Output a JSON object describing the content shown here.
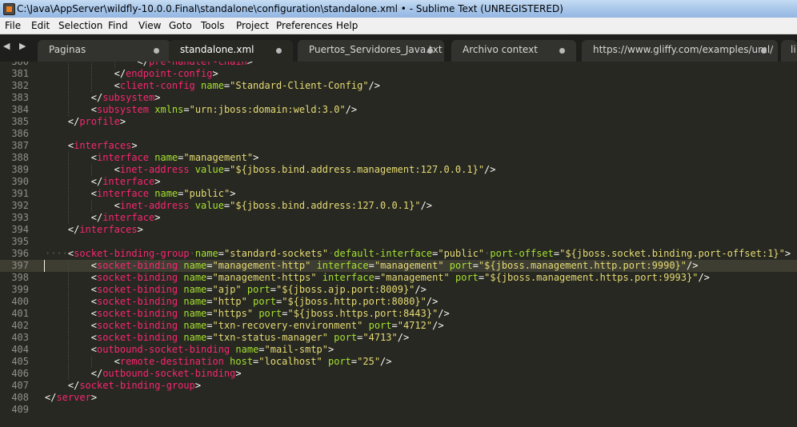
{
  "window": {
    "title": "C:\\Java\\AppServer\\wildfly-10.0.0.Final\\standalone\\configuration\\standalone.xml • - Sublime Text (UNREGISTERED)"
  },
  "menu": [
    "File",
    "Edit",
    "Selection",
    "Find",
    "View",
    "Goto",
    "Tools",
    "Project",
    "Preferences",
    "Help"
  ],
  "nav": {
    "arrows": "◀ ▶"
  },
  "tabs": [
    {
      "label": "Paginas",
      "active": false
    },
    {
      "label": "standalone.xml",
      "active": true
    },
    {
      "label": "Puertos_Servidores_Java.txt",
      "active": false
    },
    {
      "label": "Archivo context",
      "active": false
    },
    {
      "label": "https://www.gliffy.com/examples/uml/",
      "active": false
    },
    {
      "label": "li",
      "active": false
    }
  ],
  "colors": {
    "tag": "#f92672",
    "attr": "#a6e22e",
    "string": "#e6db74",
    "text": "#f8f8f2",
    "background": "#272822",
    "line_number": "#8f908a"
  },
  "editor": {
    "current_line": "397",
    "lines": [
      {
        "n": "380",
        "indent": 16,
        "tokens": [
          [
            "p",
            "</"
          ],
          [
            "t",
            "pre-handler-chain"
          ],
          [
            "p",
            ">"
          ]
        ]
      },
      {
        "n": "381",
        "indent": 12,
        "tokens": [
          [
            "p",
            "</"
          ],
          [
            "t",
            "endpoint-config"
          ],
          [
            "p",
            ">"
          ]
        ]
      },
      {
        "n": "382",
        "indent": 12,
        "tokens": [
          [
            "p",
            "<"
          ],
          [
            "t",
            "client-config"
          ],
          [
            "p",
            " "
          ],
          [
            "a",
            "name"
          ],
          [
            "p",
            "="
          ],
          [
            "s",
            "\"Standard-Client-Config\""
          ],
          [
            "p",
            "/>"
          ]
        ]
      },
      {
        "n": "383",
        "indent": 8,
        "tokens": [
          [
            "p",
            "</"
          ],
          [
            "t",
            "subsystem"
          ],
          [
            "p",
            ">"
          ]
        ]
      },
      {
        "n": "384",
        "indent": 8,
        "tokens": [
          [
            "p",
            "<"
          ],
          [
            "t",
            "subsystem"
          ],
          [
            "p",
            " "
          ],
          [
            "a",
            "xmlns"
          ],
          [
            "p",
            "="
          ],
          [
            "s",
            "\"urn:jboss:domain:weld:3.0\""
          ],
          [
            "p",
            "/>"
          ]
        ]
      },
      {
        "n": "385",
        "indent": 4,
        "tokens": [
          [
            "p",
            "</"
          ],
          [
            "t",
            "profile"
          ],
          [
            "p",
            ">"
          ]
        ]
      },
      {
        "n": "386",
        "indent": 0,
        "tokens": []
      },
      {
        "n": "387",
        "indent": 4,
        "tokens": [
          [
            "p",
            "<"
          ],
          [
            "t",
            "interfaces"
          ],
          [
            "p",
            ">"
          ]
        ]
      },
      {
        "n": "388",
        "indent": 8,
        "tokens": [
          [
            "p",
            "<"
          ],
          [
            "t",
            "interface"
          ],
          [
            "p",
            " "
          ],
          [
            "a",
            "name"
          ],
          [
            "p",
            "="
          ],
          [
            "s",
            "\"management\""
          ],
          [
            "p",
            ">"
          ]
        ]
      },
      {
        "n": "389",
        "indent": 12,
        "tokens": [
          [
            "p",
            "<"
          ],
          [
            "t",
            "inet-address"
          ],
          [
            "p",
            " "
          ],
          [
            "a",
            "value"
          ],
          [
            "p",
            "="
          ],
          [
            "s",
            "\"${jboss.bind.address.management:127.0.0.1}\""
          ],
          [
            "p",
            "/>"
          ]
        ]
      },
      {
        "n": "390",
        "indent": 8,
        "tokens": [
          [
            "p",
            "</"
          ],
          [
            "t",
            "interface"
          ],
          [
            "p",
            ">"
          ]
        ]
      },
      {
        "n": "391",
        "indent": 8,
        "tokens": [
          [
            "p",
            "<"
          ],
          [
            "t",
            "interface"
          ],
          [
            "p",
            " "
          ],
          [
            "a",
            "name"
          ],
          [
            "p",
            "="
          ],
          [
            "s",
            "\"public\""
          ],
          [
            "p",
            ">"
          ]
        ]
      },
      {
        "n": "392",
        "indent": 12,
        "tokens": [
          [
            "p",
            "<"
          ],
          [
            "t",
            "inet-address"
          ],
          [
            "p",
            " "
          ],
          [
            "a",
            "value"
          ],
          [
            "p",
            "="
          ],
          [
            "s",
            "\"${jboss.bind.address:127.0.0.1}\""
          ],
          [
            "p",
            "/>"
          ]
        ]
      },
      {
        "n": "393",
        "indent": 8,
        "tokens": [
          [
            "p",
            "</"
          ],
          [
            "t",
            "interface"
          ],
          [
            "p",
            ">"
          ]
        ]
      },
      {
        "n": "394",
        "indent": 4,
        "tokens": [
          [
            "p",
            "</"
          ],
          [
            "t",
            "interfaces"
          ],
          [
            "p",
            ">"
          ]
        ]
      },
      {
        "n": "395",
        "indent": 0,
        "tokens": []
      },
      {
        "n": "396",
        "indent": 0,
        "tokens": [
          [
            "w",
            "····"
          ],
          [
            "p",
            "<"
          ],
          [
            "t",
            "socket-binding-group"
          ],
          [
            "w",
            "·"
          ],
          [
            "a",
            "name"
          ],
          [
            "p",
            "="
          ],
          [
            "s",
            "\"standard-sockets\""
          ],
          [
            "w",
            "·"
          ],
          [
            "a",
            "default-interface"
          ],
          [
            "p",
            "="
          ],
          [
            "s",
            "\"public\""
          ],
          [
            "w",
            "·"
          ],
          [
            "a",
            "port-offset"
          ],
          [
            "p",
            "="
          ],
          [
            "s",
            "\"${jboss.socket.binding.port-offset:1}\""
          ],
          [
            "p",
            ">"
          ]
        ]
      },
      {
        "n": "397",
        "indent": 8,
        "tokens": [
          [
            "p",
            "<"
          ],
          [
            "t",
            "socket-binding"
          ],
          [
            "p",
            " "
          ],
          [
            "a",
            "name"
          ],
          [
            "p",
            "="
          ],
          [
            "s",
            "\"management-http\""
          ],
          [
            "p",
            " "
          ],
          [
            "a",
            "interface"
          ],
          [
            "p",
            "="
          ],
          [
            "s",
            "\"management\""
          ],
          [
            "p",
            " "
          ],
          [
            "a",
            "port"
          ],
          [
            "p",
            "="
          ],
          [
            "s",
            "\"${jboss.management.http.port:9990}\""
          ],
          [
            "p",
            "/>"
          ]
        ]
      },
      {
        "n": "398",
        "indent": 8,
        "tokens": [
          [
            "p",
            "<"
          ],
          [
            "t",
            "socket-binding"
          ],
          [
            "p",
            " "
          ],
          [
            "a",
            "name"
          ],
          [
            "p",
            "="
          ],
          [
            "s",
            "\"management-https\""
          ],
          [
            "p",
            " "
          ],
          [
            "a",
            "interface"
          ],
          [
            "p",
            "="
          ],
          [
            "s",
            "\"management\""
          ],
          [
            "p",
            " "
          ],
          [
            "a",
            "port"
          ],
          [
            "p",
            "="
          ],
          [
            "s",
            "\"${jboss.management.https.port:9993}\""
          ],
          [
            "p",
            "/>"
          ]
        ]
      },
      {
        "n": "399",
        "indent": 8,
        "tokens": [
          [
            "p",
            "<"
          ],
          [
            "t",
            "socket-binding"
          ],
          [
            "p",
            " "
          ],
          [
            "a",
            "name"
          ],
          [
            "p",
            "="
          ],
          [
            "s",
            "\"ajp\""
          ],
          [
            "p",
            " "
          ],
          [
            "a",
            "port"
          ],
          [
            "p",
            "="
          ],
          [
            "s",
            "\"${jboss.ajp.port:8009}\""
          ],
          [
            "p",
            "/>"
          ]
        ]
      },
      {
        "n": "400",
        "indent": 8,
        "tokens": [
          [
            "p",
            "<"
          ],
          [
            "t",
            "socket-binding"
          ],
          [
            "p",
            " "
          ],
          [
            "a",
            "name"
          ],
          [
            "p",
            "="
          ],
          [
            "s",
            "\"http\""
          ],
          [
            "p",
            " "
          ],
          [
            "a",
            "port"
          ],
          [
            "p",
            "="
          ],
          [
            "s",
            "\"${jboss.http.port:8080}\""
          ],
          [
            "p",
            "/>"
          ]
        ]
      },
      {
        "n": "401",
        "indent": 8,
        "tokens": [
          [
            "p",
            "<"
          ],
          [
            "t",
            "socket-binding"
          ],
          [
            "p",
            " "
          ],
          [
            "a",
            "name"
          ],
          [
            "p",
            "="
          ],
          [
            "s",
            "\"https\""
          ],
          [
            "p",
            " "
          ],
          [
            "a",
            "port"
          ],
          [
            "p",
            "="
          ],
          [
            "s",
            "\"${jboss.https.port:8443}\""
          ],
          [
            "p",
            "/>"
          ]
        ]
      },
      {
        "n": "402",
        "indent": 8,
        "tokens": [
          [
            "p",
            "<"
          ],
          [
            "t",
            "socket-binding"
          ],
          [
            "p",
            " "
          ],
          [
            "a",
            "name"
          ],
          [
            "p",
            "="
          ],
          [
            "s",
            "\"txn-recovery-environment\""
          ],
          [
            "p",
            " "
          ],
          [
            "a",
            "port"
          ],
          [
            "p",
            "="
          ],
          [
            "s",
            "\"4712\""
          ],
          [
            "p",
            "/>"
          ]
        ]
      },
      {
        "n": "403",
        "indent": 8,
        "tokens": [
          [
            "p",
            "<"
          ],
          [
            "t",
            "socket-binding"
          ],
          [
            "p",
            " "
          ],
          [
            "a",
            "name"
          ],
          [
            "p",
            "="
          ],
          [
            "s",
            "\"txn-status-manager\""
          ],
          [
            "p",
            " "
          ],
          [
            "a",
            "port"
          ],
          [
            "p",
            "="
          ],
          [
            "s",
            "\"4713\""
          ],
          [
            "p",
            "/>"
          ]
        ]
      },
      {
        "n": "404",
        "indent": 8,
        "tokens": [
          [
            "p",
            "<"
          ],
          [
            "t",
            "outbound-socket-binding"
          ],
          [
            "p",
            " "
          ],
          [
            "a",
            "name"
          ],
          [
            "p",
            "="
          ],
          [
            "s",
            "\"mail-smtp\""
          ],
          [
            "p",
            ">"
          ]
        ]
      },
      {
        "n": "405",
        "indent": 12,
        "tokens": [
          [
            "p",
            "<"
          ],
          [
            "t",
            "remote-destination"
          ],
          [
            "p",
            " "
          ],
          [
            "a",
            "host"
          ],
          [
            "p",
            "="
          ],
          [
            "s",
            "\"localhost\""
          ],
          [
            "p",
            " "
          ],
          [
            "a",
            "port"
          ],
          [
            "p",
            "="
          ],
          [
            "s",
            "\"25\""
          ],
          [
            "p",
            "/>"
          ]
        ]
      },
      {
        "n": "406",
        "indent": 8,
        "tokens": [
          [
            "p",
            "</"
          ],
          [
            "t",
            "outbound-socket-binding"
          ],
          [
            "p",
            ">"
          ]
        ]
      },
      {
        "n": "407",
        "indent": 4,
        "tokens": [
          [
            "p",
            "</"
          ],
          [
            "t",
            "socket-binding-group"
          ],
          [
            "p",
            ">"
          ]
        ]
      },
      {
        "n": "408",
        "indent": 0,
        "tokens": [
          [
            "p",
            "</"
          ],
          [
            "t",
            "server"
          ],
          [
            "p",
            ">"
          ]
        ]
      },
      {
        "n": "409",
        "indent": 0,
        "tokens": []
      }
    ]
  }
}
